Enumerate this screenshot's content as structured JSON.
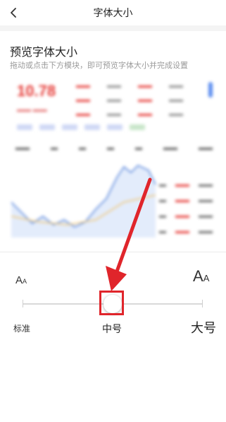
{
  "header": {
    "title": "字体大小",
    "back_icon": "chevron-left-icon"
  },
  "preview": {
    "title": "预览字体大小",
    "subtitle": "拖动或点击下方模块，即可预览字体大小并完成设置"
  },
  "font_size_control": {
    "small_sample": "A",
    "small_sample_sub": "A",
    "large_sample": "A",
    "large_sample_sub": "A",
    "selected_label": "中号",
    "stops": [
      "标准",
      "中号",
      "大号"
    ],
    "selected_index": 1,
    "position_fraction": 0.5,
    "highlight_color": "#e0252b"
  }
}
